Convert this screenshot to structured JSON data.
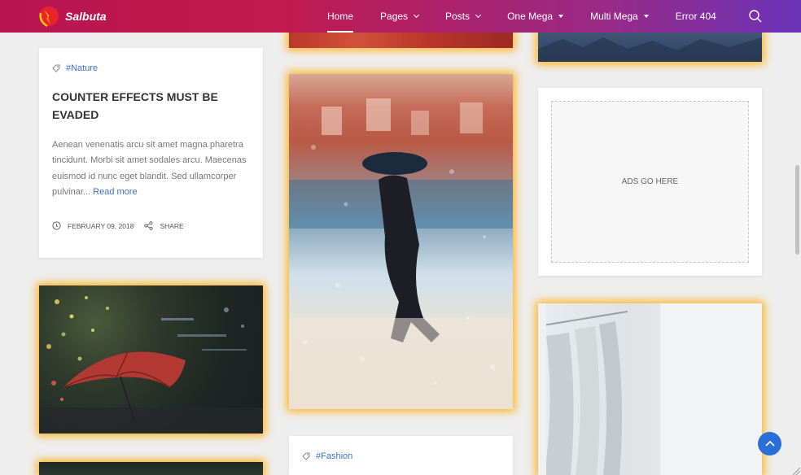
{
  "brand": {
    "name": "Salbuta"
  },
  "nav": {
    "items": [
      {
        "label": "Home"
      },
      {
        "label": "Pages"
      },
      {
        "label": "Posts"
      },
      {
        "label": "One Mega"
      },
      {
        "label": "Multi Mega"
      },
      {
        "label": "Error 404"
      }
    ]
  },
  "post_nature": {
    "tag": "#Nature",
    "title": "Counter effects must be evaded",
    "excerpt": "Aenean venenatis arcu sit amet magna pharetra tincidunt. Morbi sit amet sodales arcu. Maecenas euismod id nunc eget blandit. Sed ullamcorper pulvinar...",
    "read_more": "Read more",
    "date": "February 09, 2018",
    "share": "Share"
  },
  "post_fashion": {
    "tag": "#Fashion"
  },
  "ads": {
    "text": "ADS GO HERE"
  },
  "colors": {
    "accent": "#3b6fd6",
    "glow": "#ffaa00",
    "nav_start": "#b8154f",
    "nav_end": "#6a33b8",
    "back_to_top": "#2a6ed8"
  }
}
